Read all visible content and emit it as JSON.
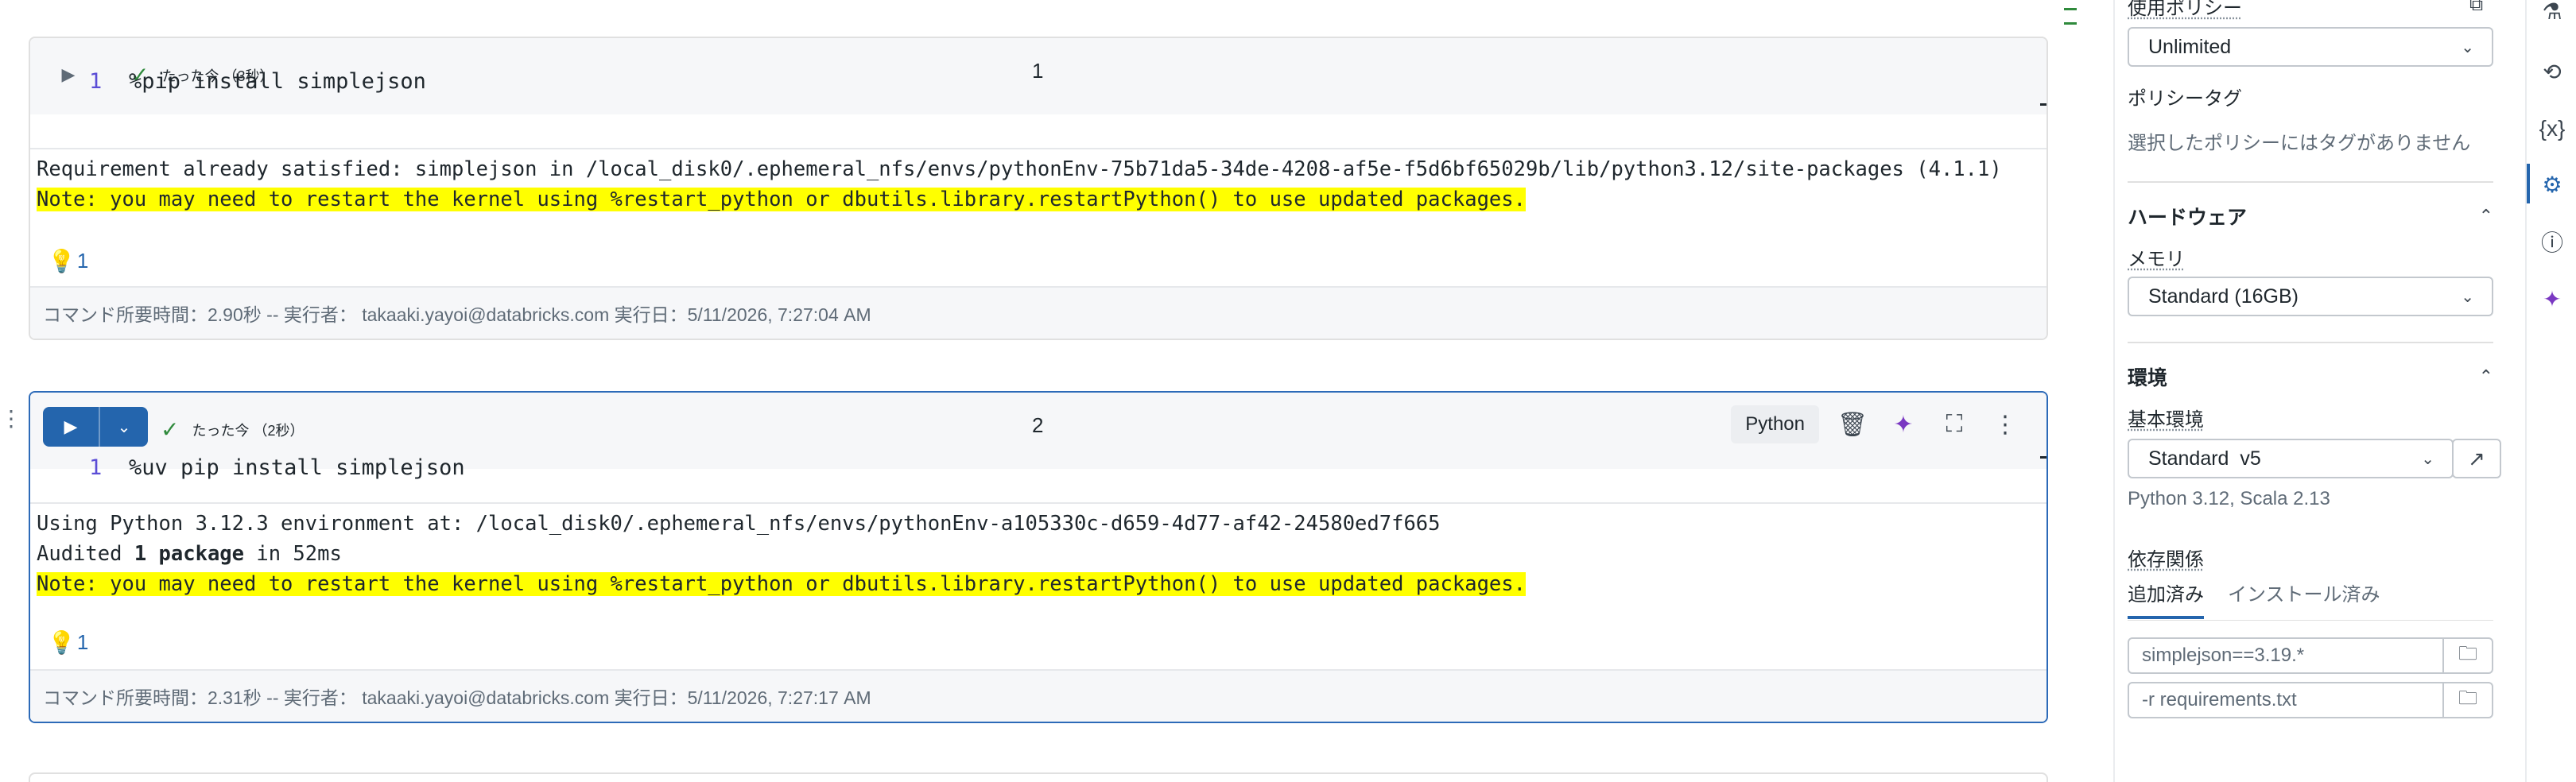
{
  "cells": [
    {
      "number": "1",
      "status": "たった今 （3秒）",
      "line_number": "1",
      "code": "%pip install simplejson",
      "output": [
        {
          "text": "Requirement already satisfied: simplejson in /local_disk0/.ephemeral_nfs/envs/pythonEnv-75b71da5-34de-4208-af5e-f5d6bf65029b/lib/python3.12/site-packages (4.1.1)",
          "highlight": false
        },
        {
          "text": "Note: you may need to restart the kernel using %restart_python or dbutils.library.restartPython() to use updated packages.",
          "highlight": true
        }
      ],
      "hint_count": "1",
      "footer": "コマンド所要時間：2.90秒 -- 実行者： takaaki.yayoi@databricks.com 実行日：5/11/2026, 7:27:04 AM"
    },
    {
      "number": "2",
      "status": "たった今 （2秒）",
      "line_number": "1",
      "code": "%uv pip install simplejson",
      "language": "Python",
      "output_line1": "Using Python 3.12.3 environment at: /local_disk0/.ephemeral_nfs/envs/pythonEnv-a105330c-d659-4d77-af42-24580ed7f665",
      "output_line2_pre": "Audited ",
      "output_line2_bold": "1 package",
      "output_line2_post": " in 52ms",
      "output_line3": "Note: you may need to restart the kernel using %restart_python or dbutils.library.restartPython() to use updated packages.",
      "hint_count": "1",
      "footer": "コマンド所要時間：2.31秒 -- 実行者： takaaki.yayoi@databricks.com 実行日：5/11/2026, 7:27:17 AM"
    }
  ],
  "panel": {
    "usage_policy_label": "使用ポリシー",
    "usage_policy_value": "Unlimited",
    "policy_tags_label": "ポリシータグ",
    "policy_tags_empty": "選択したポリシーにはタグがありません",
    "hardware_title": "ハードウェア",
    "memory_label": "メモリ",
    "memory_value": "Standard (16GB)",
    "environment_title": "環境",
    "base_env_label": "基本環境",
    "base_env_value": "Standard  v5",
    "base_env_desc": "Python 3.12, Scala 2.13",
    "dependencies_label": "依存関係",
    "tabs": [
      "追加済み",
      "インストール済み"
    ],
    "dependencies": [
      "simplejson==3.19.*",
      "-r requirements.txt"
    ]
  },
  "colors": {
    "accent": "#2465ad",
    "success": "#2f8a3c",
    "highlight": "#ffff00",
    "ai": "#7a38c2"
  }
}
